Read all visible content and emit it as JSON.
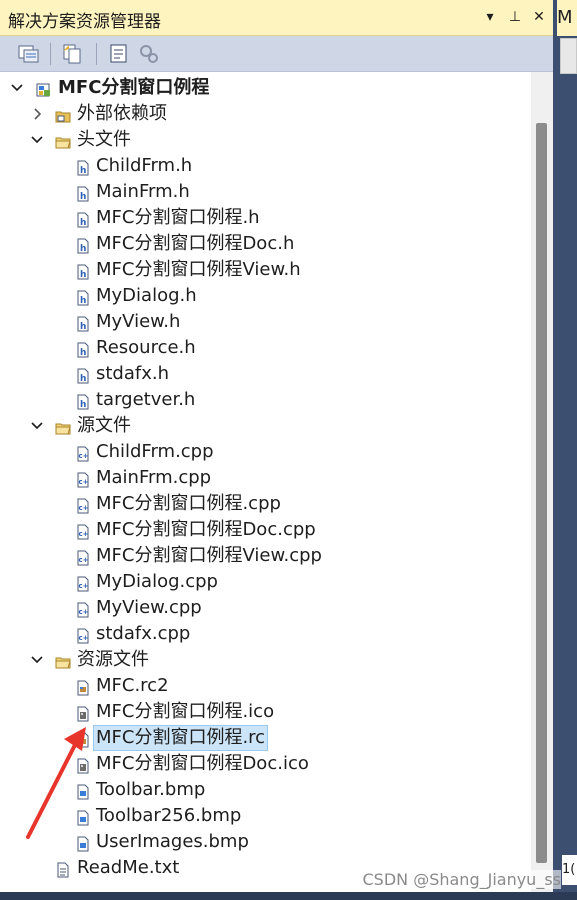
{
  "panel": {
    "title": "解决方案资源管理器",
    "pin_glyph": "▾",
    "dock_glyph": "⊥",
    "close_glyph": "✕"
  },
  "toolbar": {
    "icons": [
      "properties-icon",
      "show-all-files-icon",
      "view-class-diagram-icon",
      "refresh-icon"
    ]
  },
  "tree": {
    "items": [
      {
        "label": "MFC分割窗口例程",
        "kind": "project",
        "depth": 0,
        "expanded": true,
        "bold": true
      },
      {
        "label": "外部依赖项",
        "kind": "folder-ref",
        "depth": 1,
        "expanded": false
      },
      {
        "label": "头文件",
        "kind": "folder",
        "depth": 1,
        "expanded": true
      },
      {
        "label": "ChildFrm.h",
        "kind": "h",
        "depth": 2
      },
      {
        "label": "MainFrm.h",
        "kind": "h",
        "depth": 2
      },
      {
        "label": "MFC分割窗口例程.h",
        "kind": "h",
        "depth": 2
      },
      {
        "label": "MFC分割窗口例程Doc.h",
        "kind": "h",
        "depth": 2
      },
      {
        "label": "MFC分割窗口例程View.h",
        "kind": "h",
        "depth": 2
      },
      {
        "label": "MyDialog.h",
        "kind": "h",
        "depth": 2
      },
      {
        "label": "MyView.h",
        "kind": "h",
        "depth": 2
      },
      {
        "label": "Resource.h",
        "kind": "h",
        "depth": 2
      },
      {
        "label": "stdafx.h",
        "kind": "h",
        "depth": 2
      },
      {
        "label": "targetver.h",
        "kind": "h",
        "depth": 2
      },
      {
        "label": "源文件",
        "kind": "folder",
        "depth": 1,
        "expanded": true
      },
      {
        "label": "ChildFrm.cpp",
        "kind": "cpp",
        "depth": 2
      },
      {
        "label": "MainFrm.cpp",
        "kind": "cpp",
        "depth": 2
      },
      {
        "label": "MFC分割窗口例程.cpp",
        "kind": "cpp",
        "depth": 2
      },
      {
        "label": "MFC分割窗口例程Doc.cpp",
        "kind": "cpp",
        "depth": 2
      },
      {
        "label": "MFC分割窗口例程View.cpp",
        "kind": "cpp",
        "depth": 2
      },
      {
        "label": "MyDialog.cpp",
        "kind": "cpp",
        "depth": 2
      },
      {
        "label": "MyView.cpp",
        "kind": "cpp",
        "depth": 2
      },
      {
        "label": "stdafx.cpp",
        "kind": "cpp",
        "depth": 2
      },
      {
        "label": "资源文件",
        "kind": "folder",
        "depth": 1,
        "expanded": true
      },
      {
        "label": "MFC.rc2",
        "kind": "rc",
        "depth": 2
      },
      {
        "label": "MFC分割窗口例程.ico",
        "kind": "ico",
        "depth": 2
      },
      {
        "label": "MFC分割窗口例程.rc",
        "kind": "rc",
        "depth": 2,
        "selected": true
      },
      {
        "label": "MFC分割窗口例程Doc.ico",
        "kind": "ico",
        "depth": 2
      },
      {
        "label": "Toolbar.bmp",
        "kind": "bmp",
        "depth": 2
      },
      {
        "label": "Toolbar256.bmp",
        "kind": "bmp",
        "depth": 2
      },
      {
        "label": "UserImages.bmp",
        "kind": "bmp",
        "depth": 2
      },
      {
        "label": "ReadMe.txt",
        "kind": "txt",
        "depth": 1
      }
    ]
  },
  "right_pane": {
    "top_text": "M",
    "lower_text": "1("
  },
  "watermark": "CSDN @Shang_Jianyu_ss",
  "colors": {
    "title_bg": "#fdf4bf",
    "toolbar_bg": "#cfd6e5",
    "selection_bg": "#cce4f7",
    "annotation_arrow": "#e8352b"
  }
}
